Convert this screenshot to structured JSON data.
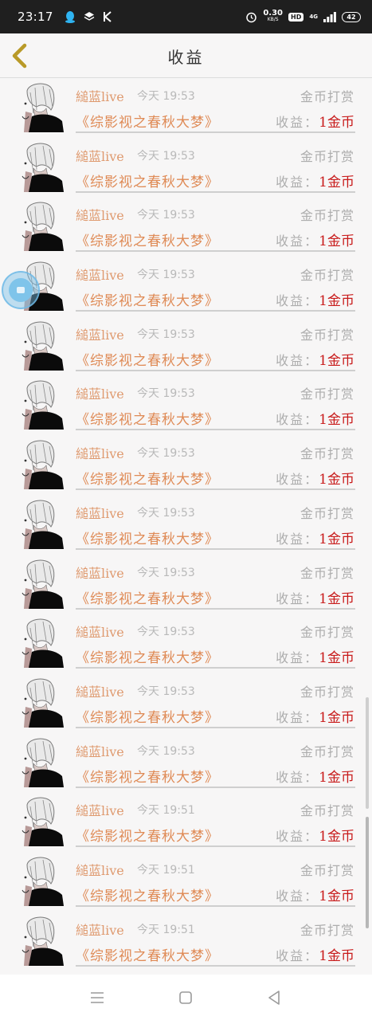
{
  "status_bar": {
    "time": "23:17",
    "net_speed_value": "0.30",
    "net_speed_unit": "KB/S",
    "hd_label": "HD",
    "network_label": "4G",
    "battery": "42"
  },
  "header": {
    "title": "收益",
    "back_icon": "chevron-left-icon"
  },
  "records": [
    {
      "name": "縋蓝live",
      "time": "今天 19:53",
      "type": "金币打赏",
      "book": "《综影视之春秋大梦》",
      "earn_label": "收益：",
      "earn_amount": "1金币"
    },
    {
      "name": "縋蓝live",
      "time": "今天 19:53",
      "type": "金币打赏",
      "book": "《综影视之春秋大梦》",
      "earn_label": "收益：",
      "earn_amount": "1金币"
    },
    {
      "name": "縋蓝live",
      "time": "今天 19:53",
      "type": "金币打赏",
      "book": "《综影视之春秋大梦》",
      "earn_label": "收益：",
      "earn_amount": "1金币"
    },
    {
      "name": "縋蓝live",
      "time": "今天 19:53",
      "type": "金币打赏",
      "book": "《综影视之春秋大梦》",
      "earn_label": "收益：",
      "earn_amount": "1金币"
    },
    {
      "name": "縋蓝live",
      "time": "今天 19:53",
      "type": "金币打赏",
      "book": "《综影视之春秋大梦》",
      "earn_label": "收益：",
      "earn_amount": "1金币"
    },
    {
      "name": "縋蓝live",
      "time": "今天 19:53",
      "type": "金币打赏",
      "book": "《综影视之春秋大梦》",
      "earn_label": "收益：",
      "earn_amount": "1金币"
    },
    {
      "name": "縋蓝live",
      "time": "今天 19:53",
      "type": "金币打赏",
      "book": "《综影视之春秋大梦》",
      "earn_label": "收益：",
      "earn_amount": "1金币"
    },
    {
      "name": "縋蓝live",
      "time": "今天 19:53",
      "type": "金币打赏",
      "book": "《综影视之春秋大梦》",
      "earn_label": "收益：",
      "earn_amount": "1金币"
    },
    {
      "name": "縋蓝live",
      "time": "今天 19:53",
      "type": "金币打赏",
      "book": "《综影视之春秋大梦》",
      "earn_label": "收益：",
      "earn_amount": "1金币"
    },
    {
      "name": "縋蓝live",
      "time": "今天 19:53",
      "type": "金币打赏",
      "book": "《综影视之春秋大梦》",
      "earn_label": "收益：",
      "earn_amount": "1金币"
    },
    {
      "name": "縋蓝live",
      "time": "今天 19:53",
      "type": "金币打赏",
      "book": "《综影视之春秋大梦》",
      "earn_label": "收益：",
      "earn_amount": "1金币"
    },
    {
      "name": "縋蓝live",
      "time": "今天 19:53",
      "type": "金币打赏",
      "book": "《综影视之春秋大梦》",
      "earn_label": "收益：",
      "earn_amount": "1金币"
    },
    {
      "name": "縋蓝live",
      "time": "今天 19:51",
      "type": "金币打赏",
      "book": "《综影视之春秋大梦》",
      "earn_label": "收益：",
      "earn_amount": "1金币"
    },
    {
      "name": "縋蓝live",
      "time": "今天 19:51",
      "type": "金币打赏",
      "book": "《综影视之春秋大梦》",
      "earn_label": "收益：",
      "earn_amount": "1金币"
    },
    {
      "name": "縋蓝live",
      "time": "今天 19:51",
      "type": "金币打赏",
      "book": "《综影视之春秋大梦》",
      "earn_label": "收益：",
      "earn_amount": "1金币"
    }
  ],
  "nav_bar": {
    "menu_icon": "menu-icon",
    "home_icon": "home-square-icon",
    "back_icon": "back-triangle-icon"
  },
  "colors": {
    "name": "#df9a6f",
    "book": "#df8a55",
    "amount": "#c81b1b",
    "muted": "#adadad",
    "back_arrow": "#b99a28"
  }
}
